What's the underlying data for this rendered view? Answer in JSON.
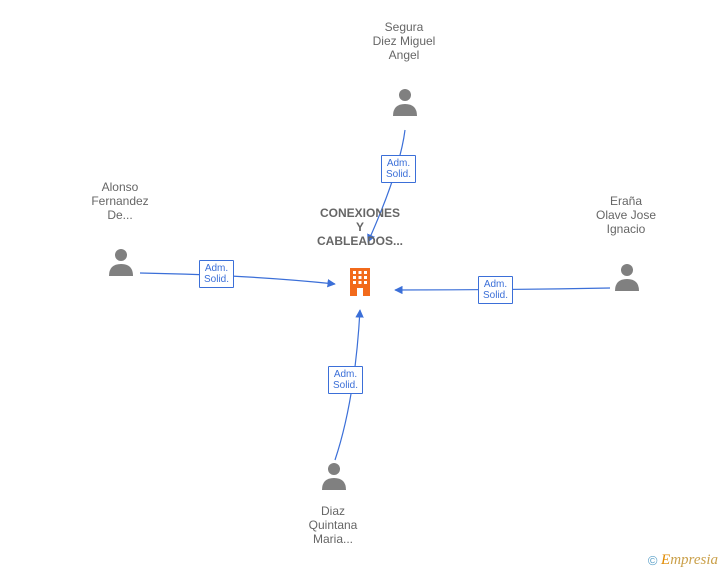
{
  "company": {
    "title_lines": [
      "CONEXIONES",
      "Y",
      "CABLEADOS..."
    ]
  },
  "people": {
    "top": {
      "name_lines": [
        "Segura",
        "Diez Miguel",
        "Angel"
      ]
    },
    "left": {
      "name_lines": [
        "Alonso",
        "Fernandez",
        "De..."
      ]
    },
    "right": {
      "name_lines": [
        "Eraña",
        "Olave Jose",
        "Ignacio"
      ]
    },
    "bottom": {
      "name_lines": [
        "Diaz",
        "Quintana",
        "Maria..."
      ]
    }
  },
  "edges": {
    "top": {
      "label_line1": "Adm.",
      "label_line2": "Solid."
    },
    "left": {
      "label_line1": "Adm.",
      "label_line2": "Solid."
    },
    "right": {
      "label_line1": "Adm.",
      "label_line2": "Solid."
    },
    "bottom": {
      "label_line1": "Adm.",
      "label_line2": "Solid."
    }
  },
  "footer": {
    "copyright": "©",
    "brand_first": "E",
    "brand_rest": "mpresia"
  }
}
